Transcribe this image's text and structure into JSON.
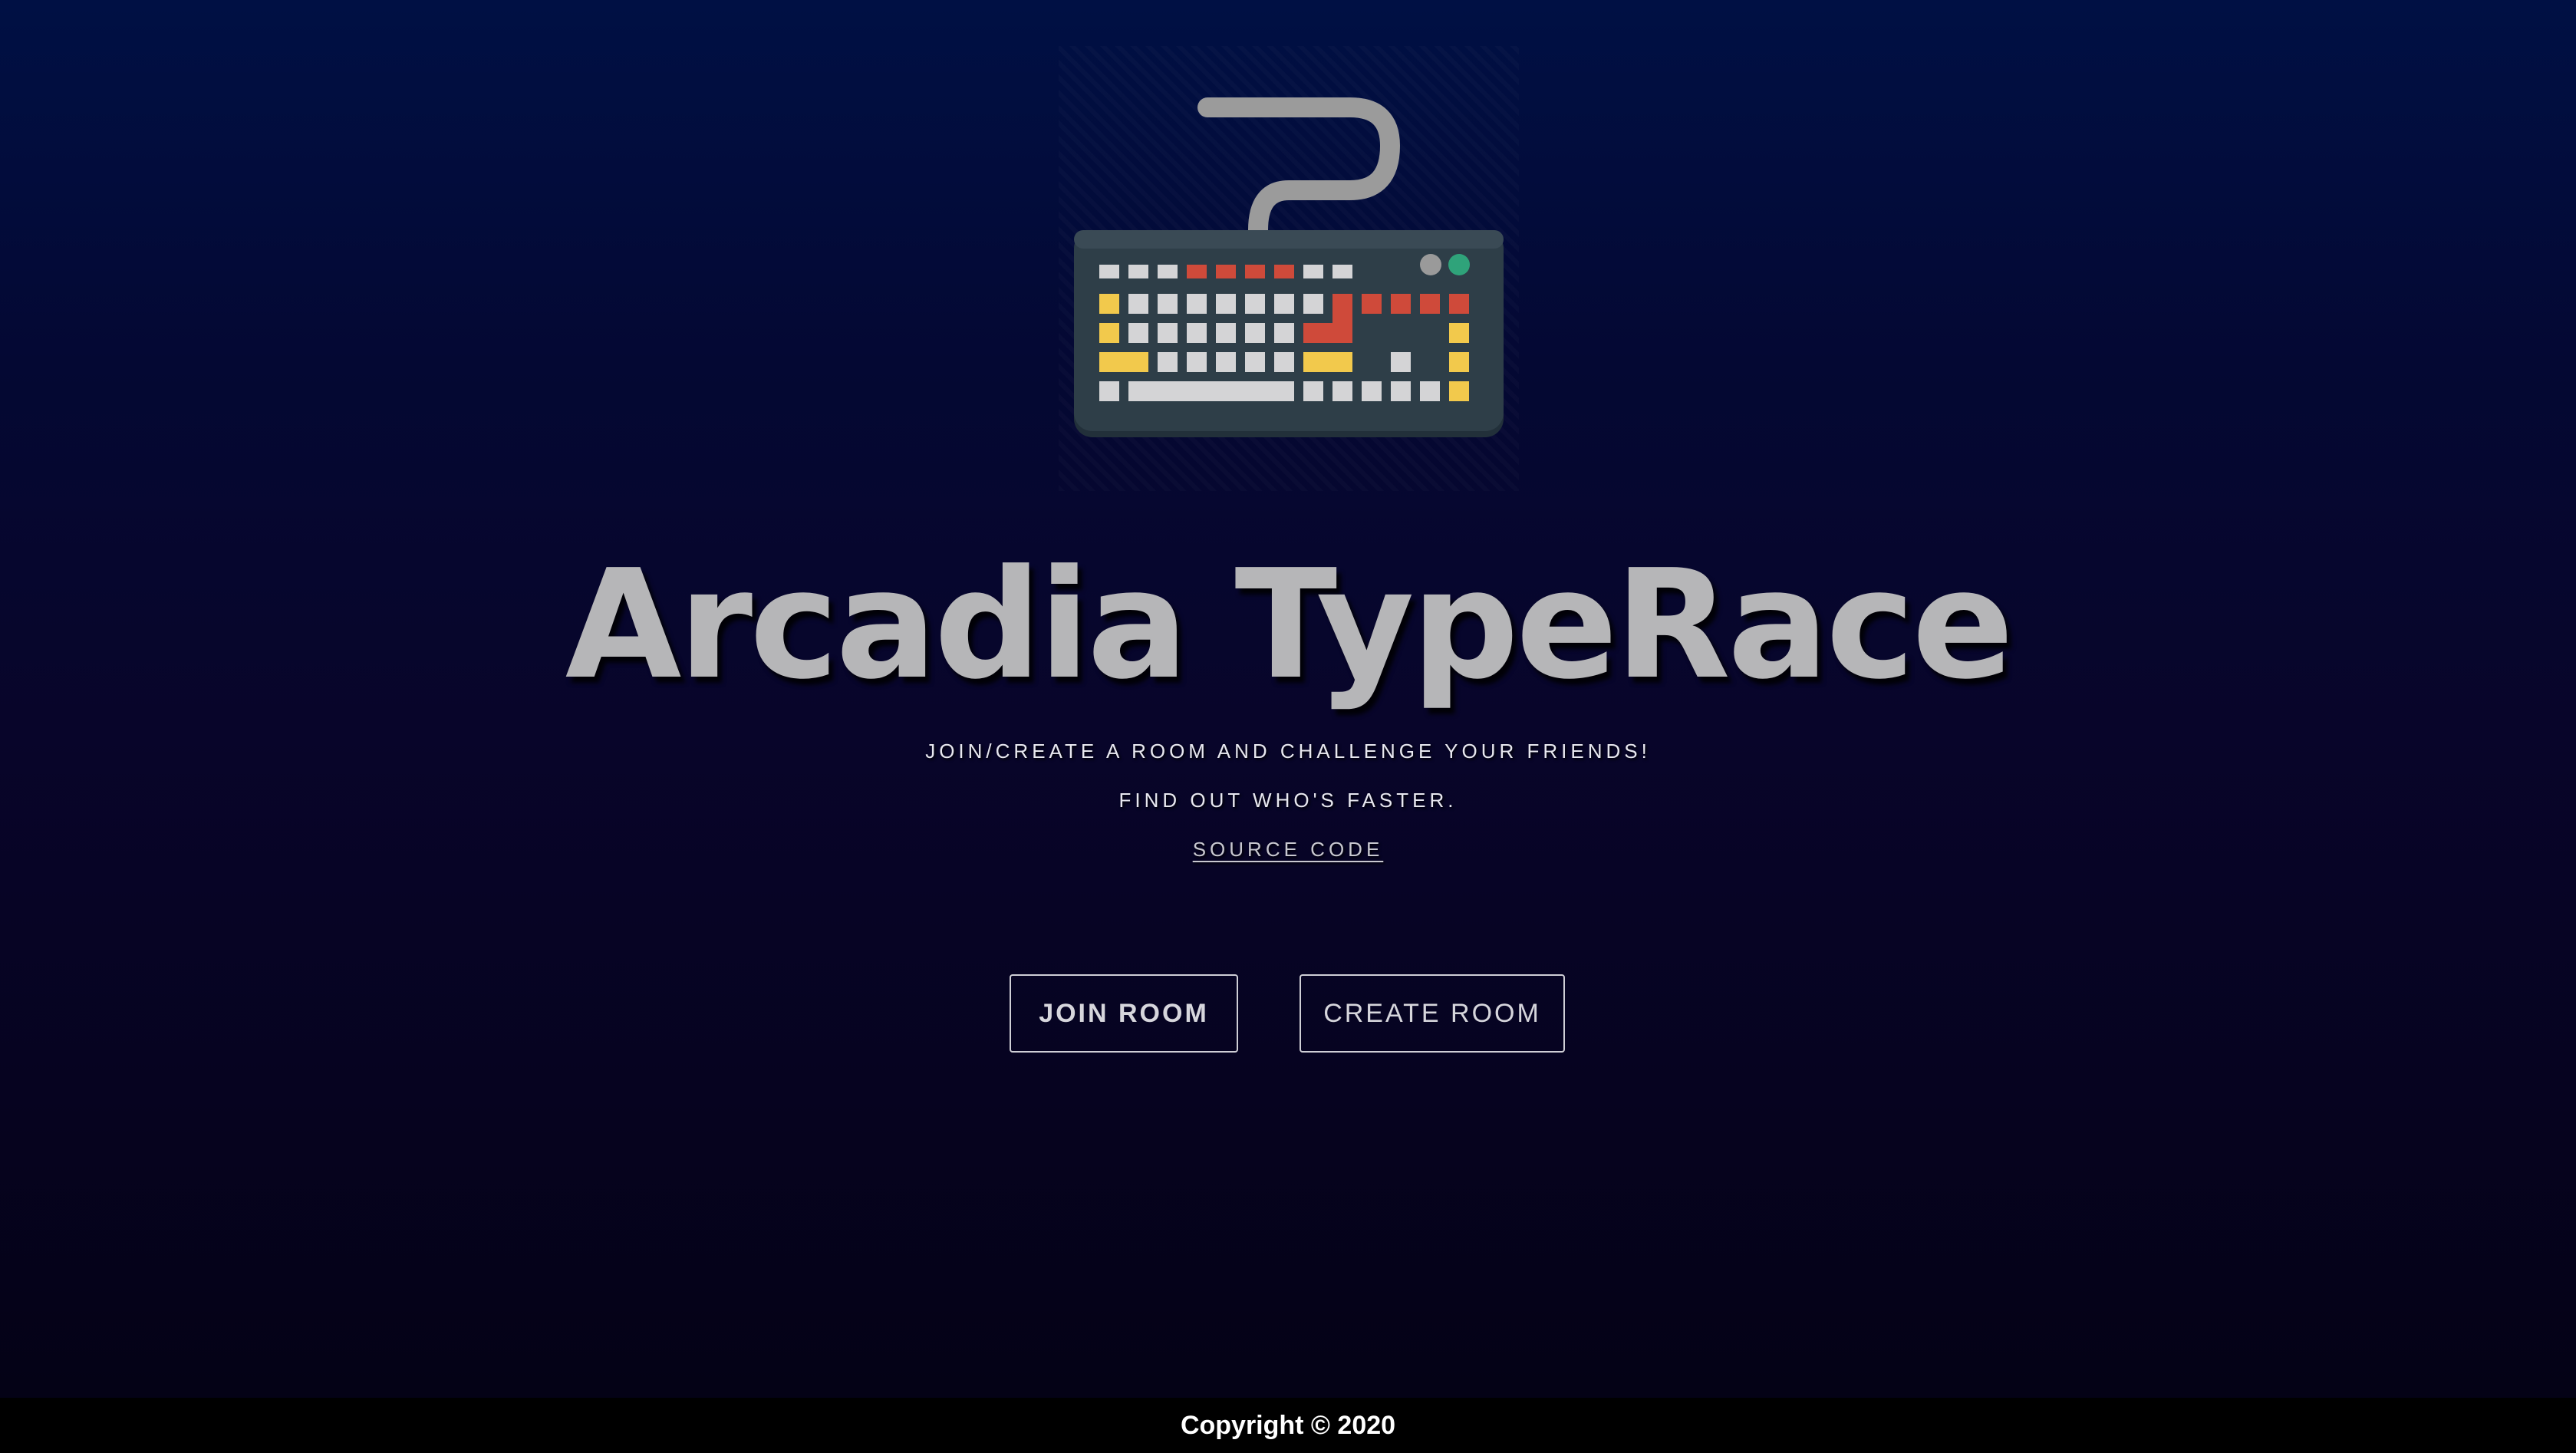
{
  "app": {
    "title": "Arcadia TypeRace",
    "logo_icon": "keyboard-icon"
  },
  "hero": {
    "tagline_1": "JOIN/CREATE A ROOM AND CHALLENGE YOUR FRIENDS!",
    "tagline_2": "FIND OUT WHO'S FASTER.",
    "source_link": "SOURCE CODE"
  },
  "actions": {
    "join_label": "JOIN ROOM",
    "create_label": "CREATE ROOM"
  },
  "footer": {
    "copyright": "Copyright © 2020"
  },
  "colors": {
    "background_top": "#001044",
    "background_bottom": "#040214",
    "title": "#b6b6b8",
    "keyboard_body": "#2e3e48",
    "key_light": "#d4d4d6",
    "key_red": "#cf4a3a",
    "key_yellow": "#f2c94c",
    "led_gray": "#9a9a9a",
    "led_green": "#2fa37a",
    "footer_bg": "#000000"
  }
}
